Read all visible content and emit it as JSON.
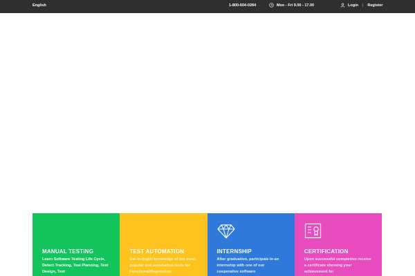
{
  "topbar": {
    "language": "English",
    "phone": "1-800-604-0284",
    "hours": "Mon - Fri 9.00 - 17.00",
    "login": "Login",
    "separator": "|",
    "register": "Register"
  },
  "cards": [
    {
      "title": "MANUAL TESTING",
      "description": "Learn Software Testing Life Cycle, Defect Tracking, Test Planning, Test Design, Test",
      "color": "#13c35b",
      "icon": "none"
    },
    {
      "title": "TEST AUTOMATION",
      "description": "Get in-depth knowledge of the most popular test automation tools for Functional/Regression",
      "color": "#ffc31f",
      "icon": "none"
    },
    {
      "title": "INTERNSHIP",
      "description": "After graduation, participate in an internship with one of our cooperative software",
      "color": "#2f79db",
      "icon": "diamond-icon"
    },
    {
      "title": "CERTIFICATION",
      "description": "Upon successful completion receive a certificate showing your achievement for",
      "color": "#e84bbe",
      "icon": "certificate-icon"
    }
  ]
}
